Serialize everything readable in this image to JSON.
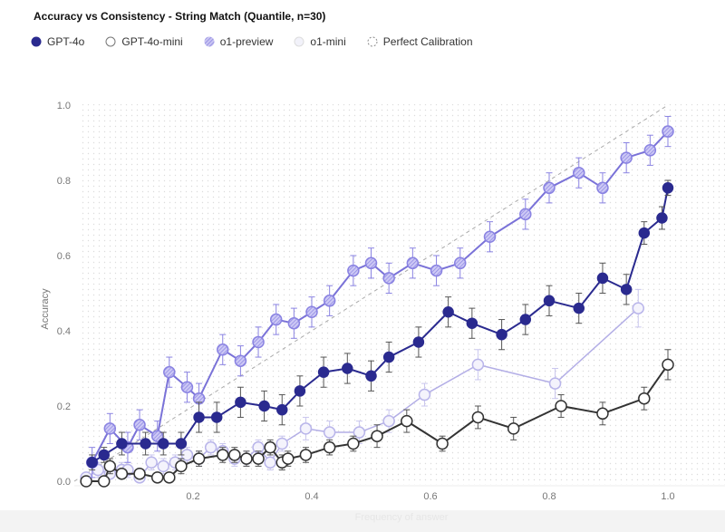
{
  "chart_data": {
    "type": "line",
    "title": "Accuracy vs Consistency - String Match (Quantile, n=30)",
    "xlabel": "Frequency of answer",
    "ylabel": "Accuracy",
    "xlim": [
      0.0,
      1.02
    ],
    "ylim": [
      0.0,
      1.0
    ],
    "x_ticks": [
      "0.2",
      "0.4",
      "0.6",
      "0.8",
      "1.0"
    ],
    "x_tick_values": [
      0.2,
      0.4,
      0.6,
      0.8,
      1.0
    ],
    "y_ticks": [
      "0.0",
      "0.2",
      "0.4",
      "0.6",
      "0.8",
      "1.0"
    ],
    "y_tick_values": [
      0.0,
      0.2,
      0.4,
      0.6,
      0.8,
      1.0
    ],
    "grid": false,
    "legend_position": "top-left",
    "reference_line": {
      "name": "Perfect Calibration",
      "x": [
        0.0,
        1.0
      ],
      "y": [
        0.0,
        1.0
      ],
      "style": "dashed",
      "color": "#aaaaaa"
    },
    "series": [
      {
        "name": "GPT-4o",
        "marker": "filled",
        "color": "#2a2a8f",
        "x": [
          0.03,
          0.05,
          0.08,
          0.12,
          0.15,
          0.18,
          0.21,
          0.24,
          0.28,
          0.32,
          0.35,
          0.38,
          0.42,
          0.46,
          0.5,
          0.53,
          0.58,
          0.63,
          0.67,
          0.72,
          0.76,
          0.8,
          0.85,
          0.89,
          0.93,
          0.96,
          0.99,
          1.0
        ],
        "y": [
          0.05,
          0.07,
          0.1,
          0.1,
          0.1,
          0.1,
          0.17,
          0.17,
          0.21,
          0.2,
          0.19,
          0.24,
          0.29,
          0.3,
          0.28,
          0.33,
          0.37,
          0.45,
          0.42,
          0.39,
          0.43,
          0.48,
          0.46,
          0.54,
          0.51,
          0.66,
          0.7,
          0.78
        ],
        "err": [
          0.02,
          0.02,
          0.03,
          0.03,
          0.03,
          0.03,
          0.04,
          0.04,
          0.04,
          0.04,
          0.04,
          0.04,
          0.04,
          0.04,
          0.04,
          0.04,
          0.04,
          0.04,
          0.04,
          0.04,
          0.04,
          0.04,
          0.04,
          0.04,
          0.04,
          0.03,
          0.03,
          0.02
        ]
      },
      {
        "name": "GPT-4o-mini",
        "marker": "open",
        "color": "#333333",
        "x": [
          0.02,
          0.05,
          0.06,
          0.08,
          0.11,
          0.14,
          0.16,
          0.18,
          0.21,
          0.25,
          0.27,
          0.29,
          0.31,
          0.33,
          0.35,
          0.36,
          0.39,
          0.43,
          0.47,
          0.51,
          0.56,
          0.62,
          0.68,
          0.74,
          0.82,
          0.89,
          0.96,
          1.0
        ],
        "y": [
          0.0,
          0.0,
          0.04,
          0.02,
          0.02,
          0.01,
          0.01,
          0.04,
          0.06,
          0.07,
          0.07,
          0.06,
          0.06,
          0.09,
          0.05,
          0.06,
          0.07,
          0.09,
          0.1,
          0.12,
          0.16,
          0.1,
          0.17,
          0.14,
          0.2,
          0.18,
          0.22,
          0.31
        ],
        "err": [
          0.01,
          0.01,
          0.02,
          0.01,
          0.01,
          0.01,
          0.01,
          0.02,
          0.02,
          0.02,
          0.02,
          0.02,
          0.02,
          0.02,
          0.02,
          0.02,
          0.02,
          0.02,
          0.02,
          0.03,
          0.03,
          0.02,
          0.03,
          0.03,
          0.03,
          0.03,
          0.03,
          0.04
        ]
      },
      {
        "name": "o1-preview",
        "marker": "hatched",
        "color": "#7a72d8",
        "x": [
          0.03,
          0.06,
          0.09,
          0.11,
          0.14,
          0.16,
          0.19,
          0.21,
          0.25,
          0.28,
          0.31,
          0.34,
          0.37,
          0.4,
          0.43,
          0.47,
          0.5,
          0.53,
          0.57,
          0.61,
          0.65,
          0.7,
          0.76,
          0.8,
          0.85,
          0.89,
          0.93,
          0.97,
          1.0
        ],
        "y": [
          0.05,
          0.14,
          0.09,
          0.15,
          0.12,
          0.29,
          0.25,
          0.22,
          0.35,
          0.32,
          0.37,
          0.43,
          0.42,
          0.45,
          0.48,
          0.56,
          0.58,
          0.54,
          0.58,
          0.56,
          0.58,
          0.65,
          0.71,
          0.78,
          0.82,
          0.78,
          0.86,
          0.88,
          0.93
        ]
      },
      {
        "name": "o1-mini",
        "marker": "open-light",
        "color": "#a9a4e0",
        "x": [
          0.02,
          0.04,
          0.06,
          0.08,
          0.09,
          0.11,
          0.13,
          0.15,
          0.17,
          0.19,
          0.21,
          0.23,
          0.25,
          0.27,
          0.29,
          0.31,
          0.33,
          0.35,
          0.39,
          0.43,
          0.48,
          0.53,
          0.59,
          0.68,
          0.81,
          0.95
        ],
        "y": [
          0.01,
          0.03,
          0.02,
          0.03,
          0.03,
          0.01,
          0.05,
          0.04,
          0.05,
          0.07,
          0.06,
          0.09,
          0.08,
          0.06,
          0.06,
          0.09,
          0.05,
          0.1,
          0.14,
          0.13,
          0.13,
          0.16,
          0.23,
          0.31,
          0.26,
          0.46
        ],
        "err": [
          0.01,
          0.02,
          0.01,
          0.02,
          0.02,
          0.01,
          0.02,
          0.02,
          0.02,
          0.02,
          0.02,
          0.02,
          0.02,
          0.02,
          0.02,
          0.02,
          0.02,
          0.02,
          0.03,
          0.03,
          0.03,
          0.03,
          0.03,
          0.04,
          0.04,
          0.05
        ]
      }
    ]
  },
  "legend": [
    {
      "label": "GPT-4o",
      "icon": "filled-circle-icon"
    },
    {
      "label": "GPT-4o-mini",
      "icon": "open-circle-icon"
    },
    {
      "label": "o1-preview",
      "icon": "hatched-circle-icon"
    },
    {
      "label": "o1-mini",
      "icon": "light-circle-icon"
    },
    {
      "label": "Perfect Calibration",
      "icon": "dashed-circle-icon"
    }
  ]
}
